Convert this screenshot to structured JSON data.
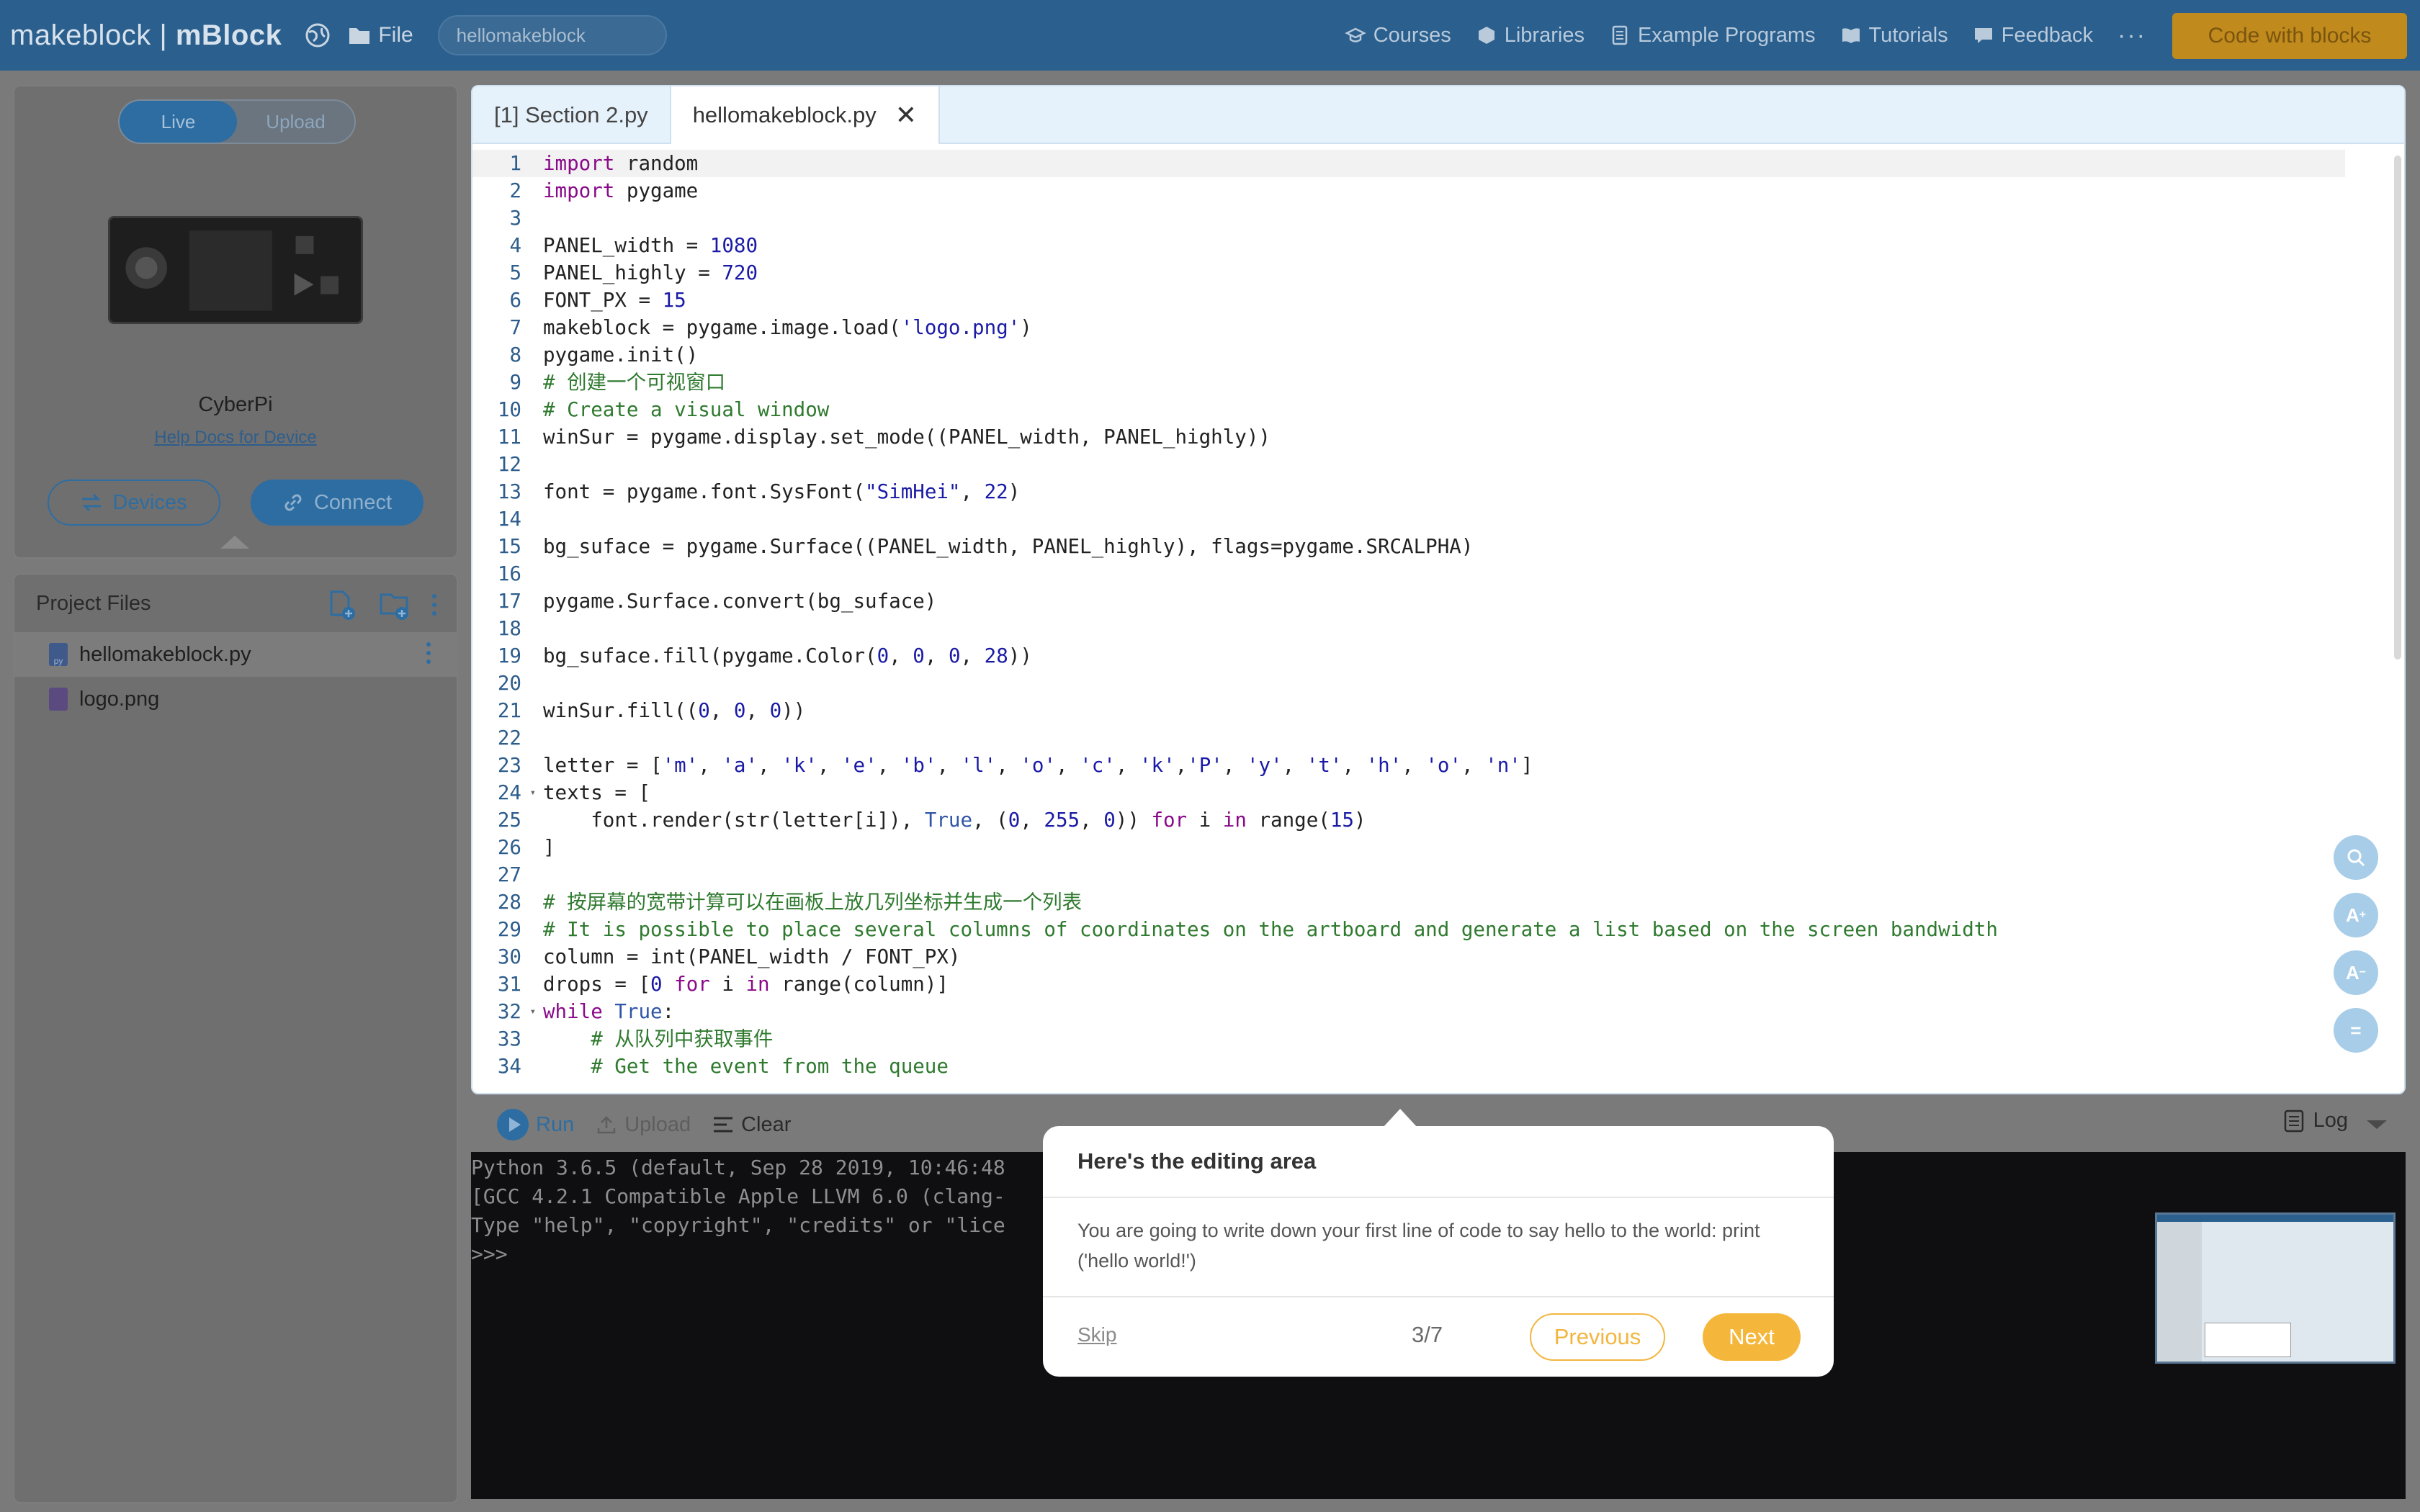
{
  "topbar": {
    "brand_left": "makeblock",
    "brand_sep": " | ",
    "brand_right": "mBlock",
    "file_label": "File",
    "project_name": "hellomakeblock",
    "nav": [
      {
        "label": "Courses",
        "icon": "courses-icon"
      },
      {
        "label": "Libraries",
        "icon": "cube-icon"
      },
      {
        "label": "Example Programs",
        "icon": "document-icon"
      },
      {
        "label": "Tutorials",
        "icon": "book-icon"
      },
      {
        "label": "Feedback",
        "icon": "chat-icon"
      }
    ],
    "more": "···",
    "code_with_blocks": "Code with blocks"
  },
  "device": {
    "mode_live": "Live",
    "mode_upload": "Upload",
    "active_mode": "Live",
    "name": "CyberPi",
    "help_link": "Help Docs for Device",
    "devices_btn": "Devices",
    "connect_btn": "Connect"
  },
  "files": {
    "title": "Project Files",
    "items": [
      {
        "name": "hellomakeblock.py",
        "type": "py",
        "selected": true
      },
      {
        "name": "logo.png",
        "type": "image",
        "selected": false
      }
    ]
  },
  "editor": {
    "tabs": [
      {
        "label": "[1] Section 2.py",
        "active": false
      },
      {
        "label": "hellomakeblock.py",
        "active": true,
        "closable": true
      }
    ],
    "close_glyph": "✕",
    "code_lines": [
      "import random",
      "import pygame",
      "",
      "PANEL_width = 1080",
      "PANEL_highly = 720",
      "FONT_PX = 15",
      "makeblock = pygame.image.load('logo.png')",
      "pygame.init()",
      "# 创建一个可视窗口",
      "# Create a visual window",
      "winSur = pygame.display.set_mode((PANEL_width, PANEL_highly))",
      "",
      "font = pygame.font.SysFont(\"SimHei\", 22)",
      "",
      "bg_suface = pygame.Surface((PANEL_width, PANEL_highly), flags=pygame.SRCALPHA)",
      "",
      "pygame.Surface.convert(bg_suface)",
      "",
      "bg_suface.fill(pygame.Color(0, 0, 0, 28))",
      "",
      "winSur.fill((0, 0, 0))",
      "",
      "letter = ['m', 'a', 'k', 'e', 'b', 'l', 'o', 'c', 'k','P', 'y', 't', 'h', 'o', 'n']",
      "texts = [",
      "    font.render(str(letter[i]), True, (0, 255, 0)) for i in range(15)",
      "]",
      "",
      "# 按屏幕的宽带计算可以在画板上放几列坐标并生成一个列表",
      "# It is possible to place several columns of coordinates on the artboard and generate a list based on the screen bandwidth",
      "column = int(PANEL_width / FONT_PX)",
      "drops = [0 for i in range(column)]",
      "while True:",
      "    # 从队列中获取事件",
      "    # Get the event from the queue"
    ],
    "fold_lines": [
      24,
      32
    ],
    "tools": [
      "search-icon",
      "font-increase-icon",
      "font-decrease-icon",
      "format-icon"
    ]
  },
  "console": {
    "run": "Run",
    "upload": "Upload",
    "clear": "Clear",
    "log": "Log",
    "lines": [
      "Python 3.6.5 (default, Sep 28 2019, 10:46:48",
      "[GCC 4.2.1 Compatible Apple LLVM 6.0 (clang-",
      "Type \"help\", \"copyright\", \"credits\" or \"lice",
      ">>>"
    ]
  },
  "tour": {
    "title": "Here's the editing area",
    "body": "You are going to write down your first line of code to say hello to the world: print ('hello world!')",
    "skip": "Skip",
    "step": "3/7",
    "previous": "Previous",
    "next": "Next"
  },
  "colors": {
    "topbar": "#2a5f8e",
    "accent": "#2d6da2",
    "tour_button": "#f5b73b"
  }
}
